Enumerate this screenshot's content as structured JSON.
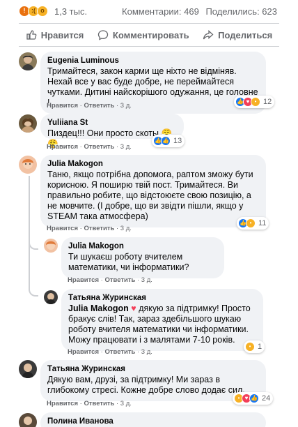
{
  "top": {
    "reactions_count": "1,3 тыс.",
    "comments": "Комментарии: 469",
    "shares": "Поделились: 623",
    "reaction_icons": [
      "angry-icon",
      "sad-icon",
      "wow-icon"
    ]
  },
  "actions": {
    "like": "Нравится",
    "comment": "Комментировать",
    "share": "Поделиться"
  },
  "colors": {
    "link": "#1877f2",
    "bubble": "#f0f2f5",
    "meta": "#65676b"
  },
  "comments": [
    {
      "author": "Eugenia Luminous",
      "text": "Тримайтеся, закон карми ще ніхто не відміняв. Нехай все у вас буде добре, не переймайтеся чутками. Дитині найскорішого одужання, це головне !",
      "like": "Нравится",
      "reply": "Ответить",
      "time": "3 д.",
      "reaction_count": "12"
    },
    {
      "author": "Yuliiana St",
      "text": "Пиздец!!! Они просто скоты 😤😤",
      "like": "Нравится",
      "reply": "Ответить",
      "time": "3 д.",
      "reaction_count": "13"
    },
    {
      "author": "Julia Makogon",
      "text": "Таню, якщо потрібна допомога, раптом зможу бути корисною. Я поширю твій пост. Тримайтеся. Ви правильно робите, що відстоюєте свою позицію, а не мовчите. (І добре, що ви звідти пішли, якщо у STEAM така атмосфера)",
      "like": "Нравится",
      "reply": "Ответить",
      "time": "3 д.",
      "reaction_count": "11"
    },
    {
      "author": "Julia Makogon",
      "text": "Ти шукаєш роботу вчителем математики, чи інформатики?",
      "like": "Нравится",
      "reply": "Ответить",
      "time": "3 д."
    },
    {
      "author": "Татьяна Журинская",
      "mention": "Julia Makogon",
      "text": "дякую за підтримку! Просто бракує слів! Так, зараз здебільшого шукаю роботу вчителя математики чи інформатики. Можу працювати і з малятами 7-10 років.",
      "like": "Нравится",
      "reply": "Ответить",
      "time": "3 д.",
      "reaction_count": "1"
    },
    {
      "author": "Татьяна Журинская",
      "text": "Дякую вам, друзі, за підтримку! Ми зараз в глибокому стресі. Кожне добре слово додає сил.",
      "like": "Нравится",
      "reply": "Ответить",
      "time": "3 д.",
      "reaction_count": "24"
    },
    {
      "author": "Полина Иванова",
      "text": ""
    }
  ]
}
